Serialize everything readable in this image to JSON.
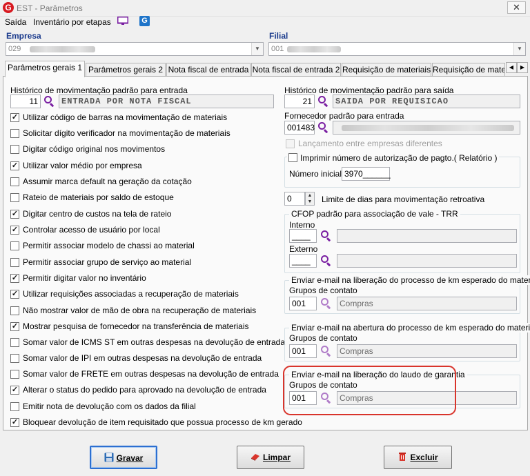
{
  "window": {
    "title": "EST - Parâmetros",
    "close_label": "✕"
  },
  "menu": {
    "saida": "Saída",
    "inventario": "Inventário por etapas",
    "g_icon": "G"
  },
  "empresa": {
    "label": "Empresa",
    "value": "029"
  },
  "filial": {
    "label": "Filial",
    "value": "001"
  },
  "tabs": [
    {
      "label": "Parâmetros gerais 1"
    },
    {
      "label": "Parâmetros gerais 2"
    },
    {
      "label": "Nota fiscal de entrada"
    },
    {
      "label": "Nota fiscal de entrada 2"
    },
    {
      "label": "Requisição de materiais"
    },
    {
      "label": "Requisição de materi"
    }
  ],
  "left": {
    "hist_entrada_label": "Histórico de movimentação padrão para entrada",
    "hist_entrada_code": "11",
    "hist_entrada_desc": "ENTRADA POR NOTA FISCAL",
    "checkboxes": [
      {
        "label": "Utilizar código de barras na movimentação de materiais",
        "checked": true
      },
      {
        "label": "Solicitar dígito verificador na movimentação de materiais",
        "checked": false
      },
      {
        "label": "Digitar código original nos movimentos",
        "checked": false
      },
      {
        "label": "Utilizar valor médio por empresa",
        "checked": true
      },
      {
        "label": "Assumir marca default na geração da cotação",
        "checked": false
      },
      {
        "label": "Rateio de materiais por saldo de estoque",
        "checked": false
      },
      {
        "label": "Digitar centro de custos na tela de rateio",
        "checked": true
      },
      {
        "label": "Controlar acesso de usuário por local",
        "checked": true
      },
      {
        "label": "Permitir associar modelo de chassi ao material",
        "checked": false
      },
      {
        "label": "Permitir associar grupo de serviço ao material",
        "checked": false
      },
      {
        "label": "Permitir digitar valor no inventário",
        "checked": true
      },
      {
        "label": "Utilizar requisições associadas a recuperação de materiais",
        "checked": true
      },
      {
        "label": "Não mostrar valor de mão de obra na recuperação de materiais",
        "checked": false
      },
      {
        "label": "Mostrar pesquisa de fornecedor na transferência de materiais",
        "checked": true
      },
      {
        "label": "Somar valor de ICMS ST em outras despesas na devolução de entrada",
        "checked": false
      },
      {
        "label": "Somar valor de IPI em outras despesas na devolução de entrada",
        "checked": false
      },
      {
        "label": "Somar valor de FRETE em outras despesas na devolução de entrada",
        "checked": false
      },
      {
        "label": "Alterar o status do pedido para aprovado na devolução de entrada",
        "checked": true
      },
      {
        "label": "Emitir nota de devolução com os dados da filial",
        "checked": false
      },
      {
        "label": "Bloquear devolução de item requisitado que possua processo de km gerado",
        "checked": true
      }
    ]
  },
  "right": {
    "hist_saida_label": "Histórico de movimentação padrão para saída",
    "hist_saida_code": "21",
    "hist_saida_desc": "SAIDA POR REQUISICAO",
    "fornecedor_label": "Fornecedor padrão para entrada",
    "fornecedor_code": "001483",
    "lancamento_label": "Lançamento entre empresas diferentes",
    "imprimir_label": "Imprimir número de autorização de pagto.( Relatório )",
    "numero_inicial_label": "Número inicial",
    "numero_inicial_value": "3970______",
    "limite_value": "0",
    "limite_label": "Limite de dias para movimentação retroativa",
    "cfop_title": "CFOP padrão para associação de vale - TRR",
    "interno_label": "Interno",
    "interno_value": "____",
    "externo_label": "Externo",
    "externo_value": "____",
    "email_groups": [
      {
        "title": "Enviar e-mail na liberação do processo de km esperado do material",
        "grupos_label": "Grupos de contato",
        "code": "001",
        "desc": "Compras"
      },
      {
        "title": "Enviar e-mail na abertura do processo de km esperado do material",
        "grupos_label": "Grupos de contato",
        "code": "001",
        "desc": "Compras"
      },
      {
        "title": "Enviar e-mail na liberação do laudo de garantia",
        "grupos_label": "Grupos de contato",
        "code": "001",
        "desc": "Compras"
      }
    ]
  },
  "buttons": {
    "gravar": "Gravar",
    "limpar": "Limpar",
    "excluir": "Excluir"
  },
  "colors": {
    "accent_label": "#1a3a8c",
    "search_icon": "#7a1fa2",
    "highlight": "#d9342b"
  }
}
